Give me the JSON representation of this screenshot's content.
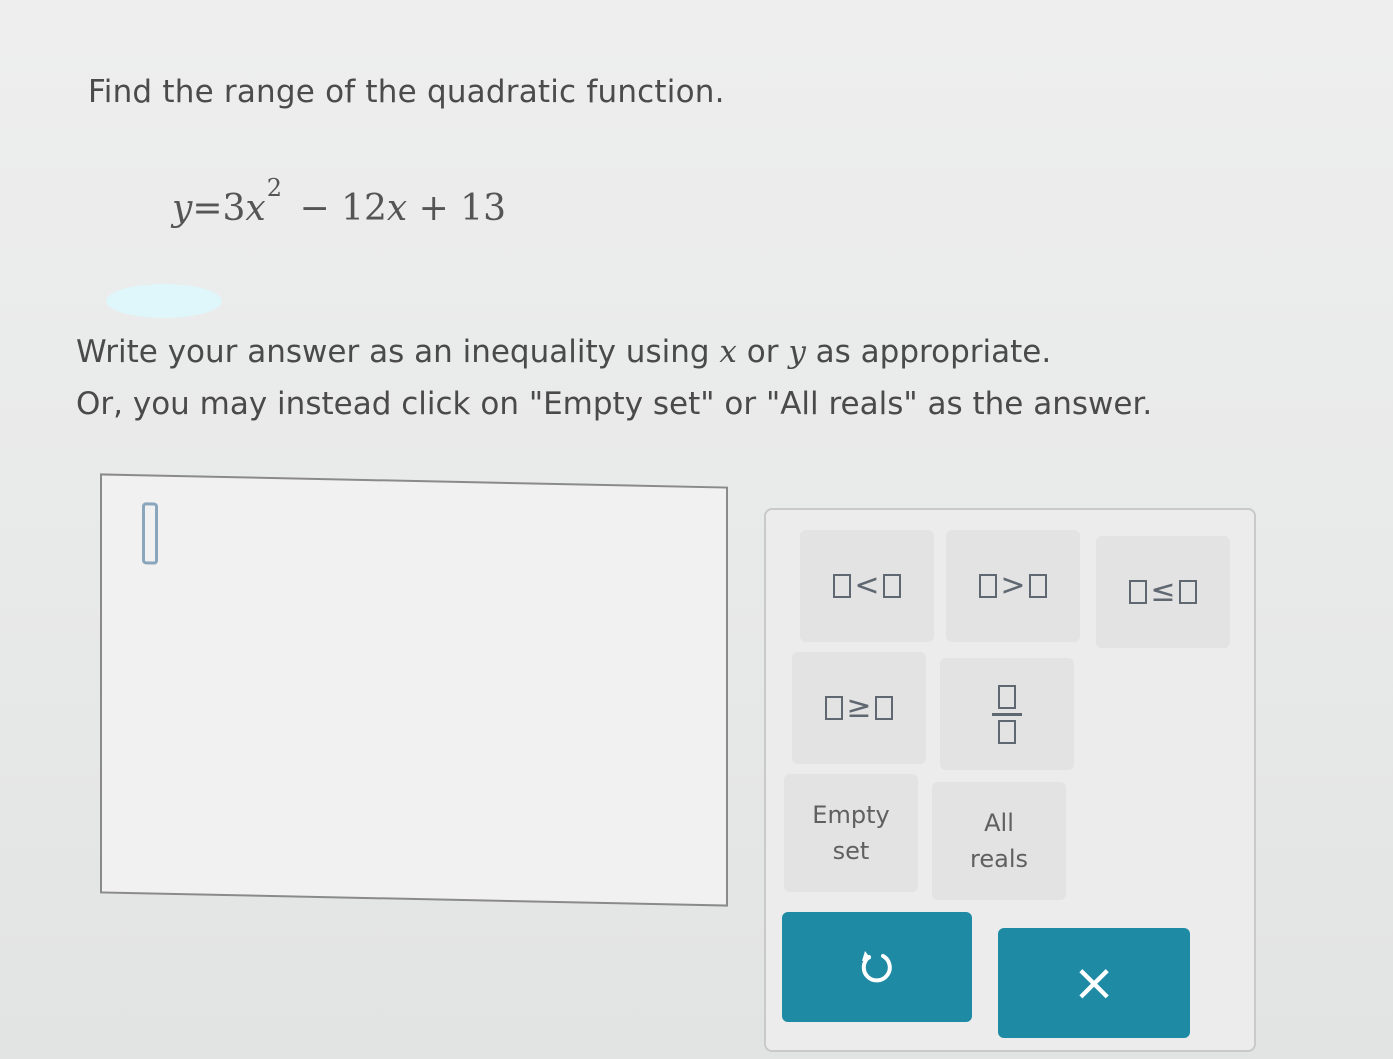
{
  "question": {
    "prompt": "Find the range of the quadratic function.",
    "equation": {
      "lhs": "y",
      "equals": "=",
      "coef_a": "3",
      "var_x": "x",
      "exponent": "2",
      "term_b": "− 12",
      "var_x2": "x",
      "term_c": "+ 13"
    },
    "instructions": {
      "line1_part1": "Write your answer as an inequality using ",
      "var1": "x",
      "line1_or": " or ",
      "var2": "y",
      "line1_part2": " as appropriate.",
      "line2": "Or, you may instead click on \"Empty set\" or \"All reals\" as the answer."
    }
  },
  "keypad": {
    "less_than": "<",
    "greater_than": ">",
    "less_equal": "≤",
    "greater_equal": "≥",
    "empty_set_line1": "Empty",
    "empty_set_line2": "set",
    "all_reals_line1": "All",
    "all_reals_line2": "reals",
    "undo_icon": "undo-arrow-icon",
    "clear_label": "×"
  },
  "colors": {
    "action_button": "#1f8aa4",
    "highlight": "#dff6fb"
  }
}
